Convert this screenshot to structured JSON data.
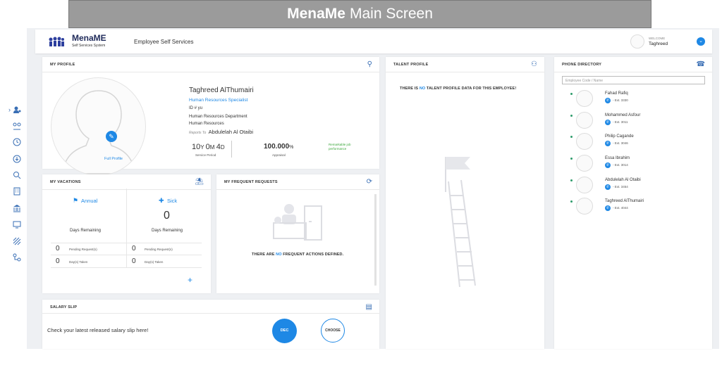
{
  "banner": {
    "brand": "MenaMe",
    "rest": "Main Screen"
  },
  "header": {
    "logo_title": "MenaME",
    "logo_sub": "Self Services System",
    "app_name": "Employee Self Services",
    "welcome": "WELCOME",
    "user": "Taghreed"
  },
  "profile": {
    "title": "MY PROFILE",
    "name": "Taghreed AlThumairi",
    "job": "Human Resources Specialist",
    "id_line": "ID # yu",
    "department": "Human Resources Department",
    "section": "Human Resources",
    "reports_to_label": "Reports To",
    "manager": "Abdulelah Al Otaibi",
    "service_y": "10",
    "service_m": "0",
    "service_d": "4",
    "service_label": "Service Period",
    "appraisal": "100.000",
    "appraisal_unit": "%",
    "appraisal_label": "Appraisal",
    "remark": "Remarkable job performance",
    "full_profile": "Full Profile"
  },
  "talent": {
    "title": "TALENT PROFILE",
    "msg_a": "THERE IS",
    "msg_hl": "NO",
    "msg_b": "TALENT PROFILE DATA FOR THIS EMPLOYEE!"
  },
  "phone": {
    "title": "PHONE DIRECTORY",
    "placeholder": "Employee Code / Name",
    "items": [
      {
        "name": "Fahad Rafiq",
        "ext": "- Ext. 3330"
      },
      {
        "name": "Mohammed Asfour",
        "ext": "- Ext. 3011"
      },
      {
        "name": "Philip Cagande",
        "ext": "- Ext. 3046"
      },
      {
        "name": "Essa Ibrahim",
        "ext": "- Ext. 3014"
      },
      {
        "name": "Abdulelah Al Otaibi",
        "ext": "- Ext. 3454"
      },
      {
        "name": "Taghreed AlThumairi",
        "ext": "- Ext. 4044"
      }
    ]
  },
  "vacations": {
    "title": "MY VACATIONS",
    "annual": {
      "label": "Annual",
      "days": "",
      "days_label": "Days Remaining",
      "pending": "0",
      "taken": "0"
    },
    "sick": {
      "label": "Sick",
      "days": "0",
      "days_label": "Days Remaining",
      "pending": "0",
      "taken": "0"
    },
    "pending_label": "Pending Request(s)",
    "taken_label": "Day(s) Taken",
    "add": "+"
  },
  "requests": {
    "title": "MY FREQUENT REQUESTS",
    "msg_a": "THERE ARE",
    "msg_hl": "NO",
    "msg_b": "FREQUENT ACTIONS DEFINED."
  },
  "salary": {
    "title": "SALARY SLIP",
    "text": "Check your latest released salary slip here!",
    "dec": "DEC",
    "choose": "CHOOSE"
  }
}
